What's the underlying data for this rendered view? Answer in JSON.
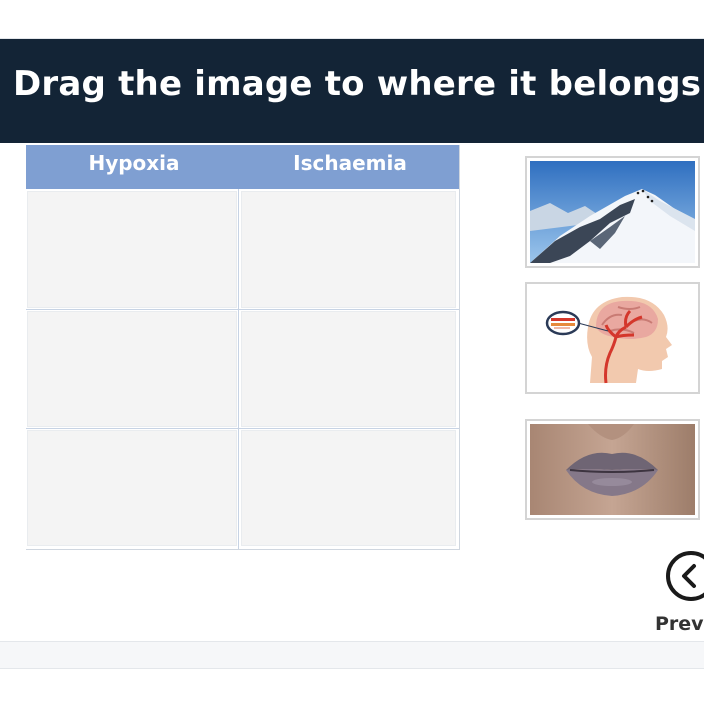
{
  "header": {
    "title": "Drag the image to where it belongs"
  },
  "table": {
    "columns": [
      "Hypoxia",
      "Ischaemia"
    ]
  },
  "images": [
    {
      "icon": "mountain-climbers-image"
    },
    {
      "icon": "brain-artery-diagram-image"
    },
    {
      "icon": "blue-lips-image"
    }
  ],
  "nav": {
    "prev_label": "Previ"
  },
  "colors": {
    "header_bg": "#132436",
    "table_header_bg": "#7f9fd2",
    "drop_zone_bg": "#f4f4f4"
  }
}
